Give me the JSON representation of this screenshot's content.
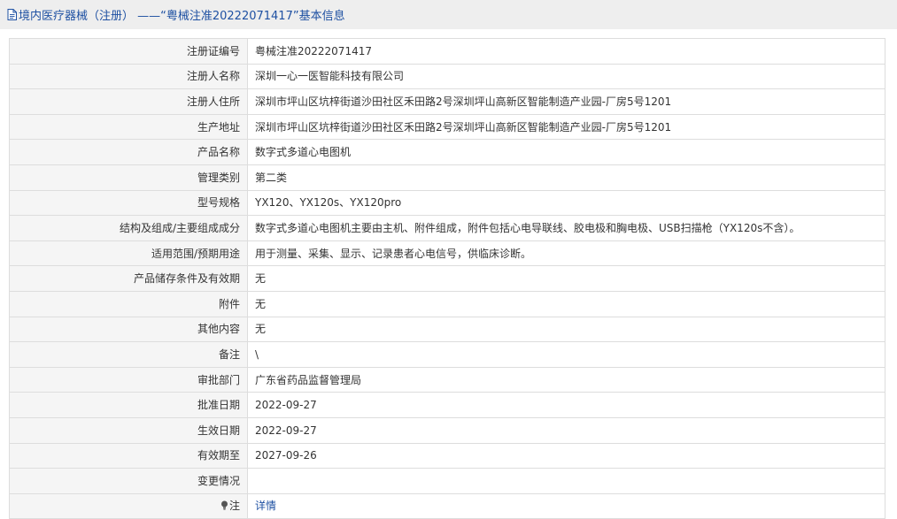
{
  "page": {
    "title": "境内医疗器械（注册） ——“粤械注准20222071417”基本信息",
    "title_icon": "document-icon"
  },
  "colors": {
    "title_bg": "#eeeeee",
    "title_text": "#1e50a2",
    "label_bg": "#f5f5f5",
    "border": "#dddddd",
    "link": "#1e50a2"
  },
  "rows": [
    {
      "key": "registration-number",
      "label": "注册证编号",
      "value": "粤械注准20222071417"
    },
    {
      "key": "registrant-name",
      "label": "注册人名称",
      "value": "深圳一心一医智能科技有限公司"
    },
    {
      "key": "registrant-address",
      "label": "注册人住所",
      "value": "深圳市坪山区坑梓街道沙田社区禾田路2号深圳坪山高新区智能制造产业园-厂房5号1201"
    },
    {
      "key": "production-address",
      "label": "生产地址",
      "value": "深圳市坪山区坑梓街道沙田社区禾田路2号深圳坪山高新区智能制造产业园-厂房5号1201"
    },
    {
      "key": "product-name",
      "label": "产品名称",
      "value": "数字式多道心电图机"
    },
    {
      "key": "management-category",
      "label": "管理类别",
      "value": "第二类"
    },
    {
      "key": "model-spec",
      "label": "型号规格",
      "value": "YX120、YX120s、YX120pro"
    },
    {
      "key": "structure-composition",
      "label": "结构及组成/主要组成成分",
      "value": "数字式多道心电图机主要由主机、附件组成，附件包括心电导联线、胶电极和胸电极、USB扫描枪（YX120s不含）。"
    },
    {
      "key": "intended-use",
      "label": "适用范围/预期用途",
      "value": "用于测量、采集、显示、记录患者心电信号，供临床诊断。"
    },
    {
      "key": "storage-validity",
      "label": "产品储存条件及有效期",
      "value": "无"
    },
    {
      "key": "attachment",
      "label": "附件",
      "value": "无"
    },
    {
      "key": "other-content",
      "label": "其他内容",
      "value": "无"
    },
    {
      "key": "remarks",
      "label": "备注",
      "value": "\\"
    },
    {
      "key": "approval-dept",
      "label": "审批部门",
      "value": "广东省药品监督管理局"
    },
    {
      "key": "approval-date",
      "label": "批准日期",
      "value": "2022-09-27"
    },
    {
      "key": "effective-date",
      "label": "生效日期",
      "value": "2022-09-27"
    },
    {
      "key": "valid-until",
      "label": "有效期至",
      "value": "2027-09-26"
    },
    {
      "key": "change-info",
      "label": "变更情况",
      "value": ""
    }
  ],
  "note_row": {
    "icon": "lightbulb-icon",
    "label": "注",
    "link_text": "详情"
  }
}
